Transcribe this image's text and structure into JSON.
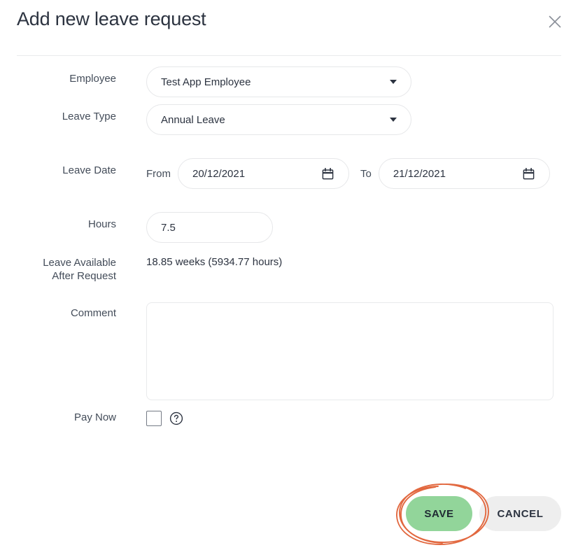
{
  "dialog": {
    "title": "Add new leave request",
    "close_icon": "close-icon"
  },
  "form": {
    "employee": {
      "label": "Employee",
      "value": "Test App Employee",
      "caret_icon": "chevron-down-icon"
    },
    "leave_type": {
      "label": "Leave Type",
      "value": "Annual Leave",
      "caret_icon": "chevron-down-icon"
    },
    "leave_date": {
      "label": "Leave Date",
      "from_label": "From",
      "from_value": "20/12/2021",
      "to_label": "To",
      "to_value": "21/12/2021",
      "calendar_icon": "calendar-icon"
    },
    "hours": {
      "label": "Hours",
      "value": "7.5"
    },
    "leave_available": {
      "label_line1": "Leave Available",
      "label_line2": "After Request",
      "value": "18.85 weeks (5934.77 hours)"
    },
    "comment": {
      "label": "Comment",
      "value": "",
      "placeholder": ""
    },
    "pay_now": {
      "label": "Pay Now",
      "checked": false,
      "help_icon": "question-circle-icon"
    }
  },
  "footer": {
    "save_label": "SAVE",
    "cancel_label": "CANCEL"
  },
  "annotation": {
    "type": "hand-drawn-ellipse",
    "target": "save-button",
    "color": "#e2683f"
  },
  "colors": {
    "save_green": "#92d59a",
    "cancel_gray": "#eeeeee",
    "text_dark": "#2c3340",
    "label_gray": "#434c59",
    "border_light": "#e6e7e9",
    "annotation_orange": "#e2683f"
  }
}
